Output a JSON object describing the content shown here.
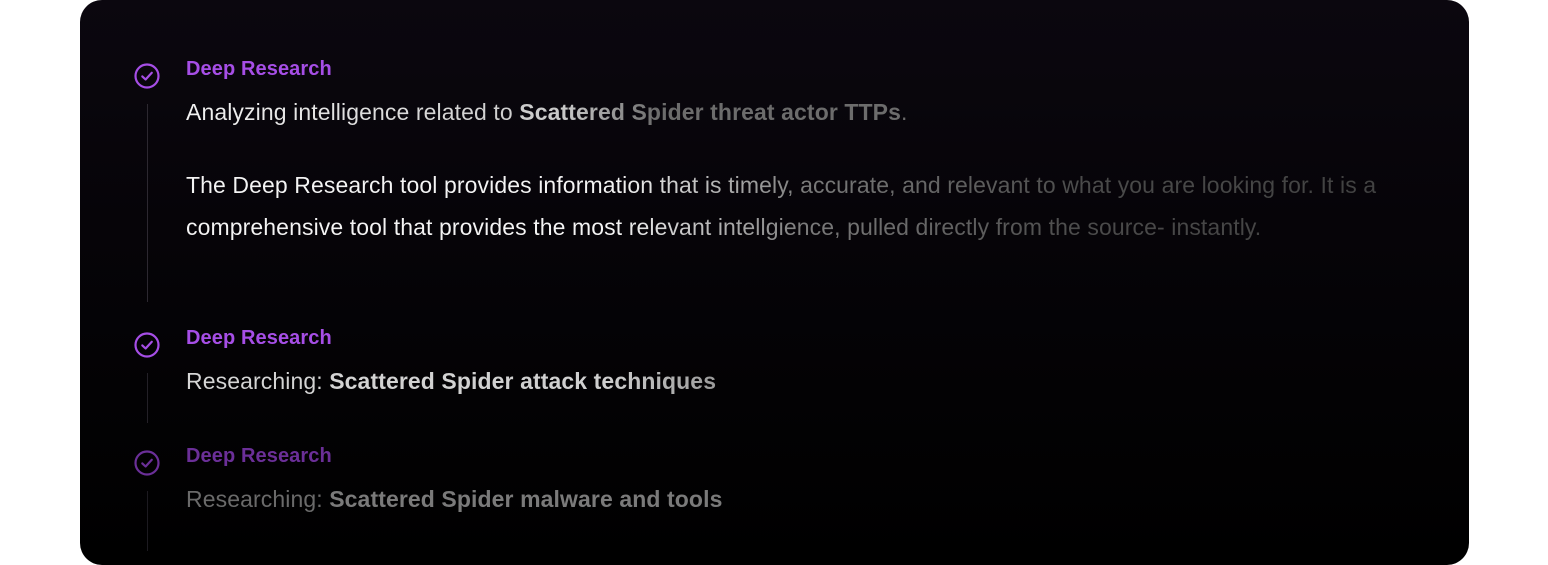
{
  "steps": [
    {
      "title": "Deep Research",
      "line_prefix": "Analyzing intelligence related to ",
      "line_bold": "Scattered Spider threat actor TTPs",
      "line_suffix": ".",
      "paragraph": "The Deep Research tool provides information that is timely, accurate, and relevant to what you are looking for. It is a comprehensive tool that provides the most relevant intellgience, pulled directly from the source- instantly.",
      "status": "done"
    },
    {
      "title": "Deep Research",
      "line_prefix": "Researching: ",
      "line_bold": "Scattered Spider attack techniques",
      "status": "done"
    },
    {
      "title": "Deep Research",
      "line_prefix": "Researching: ",
      "line_bold": "Scattered Spider malware and tools",
      "status": "done"
    }
  ],
  "icons": {
    "step_icon": "check-circle-icon"
  },
  "colors": {
    "accent": "#a64ee6",
    "accent_dim": "#6b2f98",
    "card_background": "#000000",
    "text_primary": "#f2f2f2"
  }
}
